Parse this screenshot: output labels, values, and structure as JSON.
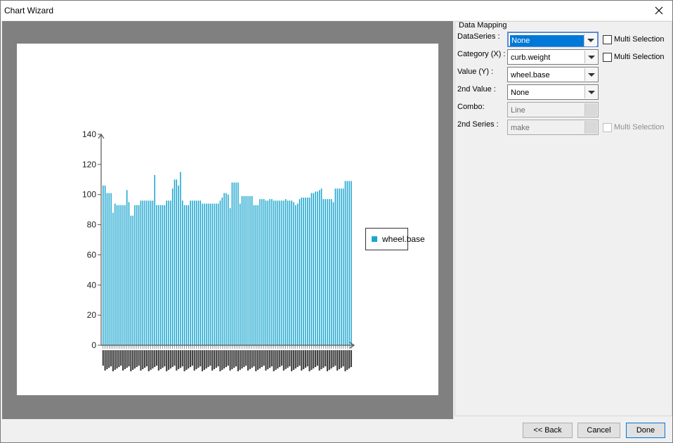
{
  "window": {
    "title": "Chart Wizard"
  },
  "mapping": {
    "title": "Data Mapping",
    "rows": [
      {
        "label": "DataSeries :",
        "value": "None",
        "has_checkbox": true,
        "checkbox_label": "Multi Selection"
      },
      {
        "label": "Category (X) :",
        "value": "curb.weight",
        "has_checkbox": true,
        "checkbox_label": "Multi Selection"
      },
      {
        "label": "Value (Y) :",
        "value": "wheel.base"
      },
      {
        "label": "2nd Value :",
        "value": "None"
      },
      {
        "label": "Combo:",
        "value": "Line"
      },
      {
        "label": "2nd Series :",
        "value": "make",
        "checkbox_label": "Multi Selection"
      }
    ]
  },
  "buttons": {
    "back": "<< Back",
    "cancel": "Cancel",
    "done": "Done"
  },
  "colors": {
    "bar": "#1ba6cf",
    "axis": "#555555"
  },
  "chart_data": {
    "type": "bar",
    "legend": {
      "entries": [
        "wheel.base"
      ],
      "position": "right"
    },
    "ylim": [
      0,
      140
    ],
    "yticks": [
      0,
      20,
      40,
      60,
      80,
      100,
      120,
      140
    ],
    "series": [
      {
        "name": "wheel.base",
        "values": [
          106,
          106,
          101,
          101,
          101,
          88,
          94,
          93,
          93,
          93,
          93,
          93,
          103,
          95,
          86,
          86,
          93,
          93,
          93,
          96,
          96,
          96,
          96,
          96,
          96,
          96,
          113,
          93,
          93,
          93,
          93,
          93,
          96,
          96,
          96,
          104,
          110,
          110,
          106,
          115,
          96,
          93,
          93,
          93,
          96,
          96,
          96,
          96,
          96,
          96,
          94,
          94,
          94,
          94,
          94,
          94,
          94,
          94,
          94,
          96,
          98,
          101,
          101,
          100,
          91,
          108,
          108,
          108,
          108,
          94,
          99,
          99,
          99,
          99,
          99,
          99,
          93,
          93,
          93,
          97,
          97,
          97,
          96,
          96,
          97,
          97,
          96,
          96,
          96,
          96,
          96,
          96,
          97,
          96,
          96,
          96,
          95,
          93,
          94,
          97,
          98,
          98,
          98,
          98,
          98,
          101,
          101,
          102,
          102,
          103,
          104,
          97,
          97,
          97,
          97,
          97,
          95,
          104,
          104,
          104,
          104,
          104,
          109,
          109,
          109,
          109
        ]
      }
    ]
  }
}
